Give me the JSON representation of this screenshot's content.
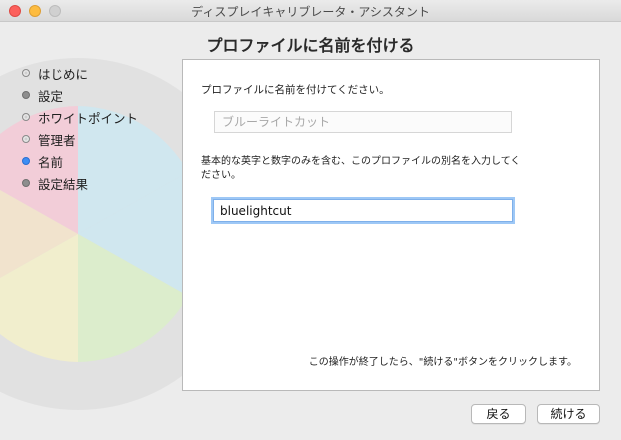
{
  "window": {
    "title": "ディスプレイキャリブレータ・アシスタント"
  },
  "page": {
    "title": "プロファイルに名前を付ける"
  },
  "steps": [
    {
      "label": "はじめに",
      "state": "done"
    },
    {
      "label": "設定",
      "state": "done"
    },
    {
      "label": "ホワイトポイント",
      "state": "done"
    },
    {
      "label": "管理者",
      "state": "done"
    },
    {
      "label": "名前",
      "state": "current"
    },
    {
      "label": "設定結果",
      "state": "upcoming"
    }
  ],
  "panel": {
    "prompt_name": "プロファイルに名前を付けてください。",
    "name_placeholder": "ブルーライトカット",
    "prompt_alias": "基本的な英字と数字のみを含む、このプロファイルの別名を入力してください。",
    "alias_value": "bluelightcut",
    "footer_note": "この操作が終了したら、\"続ける\"ボタンをクリックします。"
  },
  "buttons": {
    "back": "戻る",
    "continue": "続ける"
  },
  "colors": {
    "accent": "#3d8ef4",
    "close": "#fc605c",
    "minimize": "#fdbc40",
    "zoom_disabled": "#d0d0d0",
    "bg_wedge_pink": "#f4c9d6",
    "bg_wedge_blue": "#cde7f1",
    "bg_wedge_yellow": "#f3f0c9",
    "bg_wedge_green": "#dbeec8"
  }
}
